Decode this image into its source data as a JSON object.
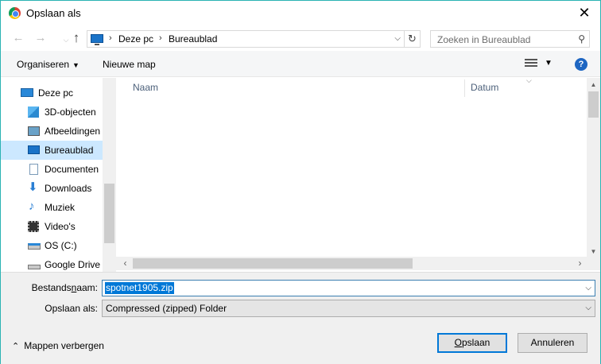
{
  "window": {
    "title": "Opslaan als",
    "close_symbol": "✕"
  },
  "nav": {
    "back_icon": "arrow-left-icon",
    "forward_icon": "arrow-right-icon",
    "up_icon": "arrow-up-icon"
  },
  "address": {
    "crumbs": [
      "Deze pc",
      "Bureaublad"
    ],
    "icon": "computer-icon"
  },
  "search": {
    "placeholder": "Zoeken in Bureaublad"
  },
  "toolbar": {
    "organize": "Organiseren",
    "new_folder": "Nieuwe map",
    "help": "?"
  },
  "sidebar": {
    "items": [
      {
        "label": "Deze pc",
        "icon": "computer-icon",
        "selected": false
      },
      {
        "label": "3D-objecten",
        "icon": "cube-icon",
        "selected": false
      },
      {
        "label": "Afbeeldingen",
        "icon": "pictures-icon",
        "selected": false
      },
      {
        "label": "Bureaublad",
        "icon": "desktop-icon",
        "selected": true
      },
      {
        "label": "Documenten",
        "icon": "documents-icon",
        "selected": false
      },
      {
        "label": "Downloads",
        "icon": "download-icon",
        "selected": false
      },
      {
        "label": "Muziek",
        "icon": "music-icon",
        "selected": false
      },
      {
        "label": "Video's",
        "icon": "video-icon",
        "selected": false
      },
      {
        "label": "OS (C:)",
        "icon": "drive-icon",
        "selected": false
      },
      {
        "label": "Google Drive F",
        "icon": "drive-icon",
        "selected": false
      }
    ]
  },
  "file_list": {
    "columns": [
      "Naam",
      "Datum"
    ]
  },
  "form": {
    "filename_label_pre": "Bestands",
    "filename_label_u": "n",
    "filename_label_post": "aam:",
    "filename_value": "spotnet1905.zip",
    "type_label_pre": "Opslaan als:",
    "type_value": "Compressed (zipped) Folder"
  },
  "footer": {
    "hide_folders": "Mappen verbergen",
    "save_pre": "",
    "save_u": "O",
    "save_post": "pslaan",
    "cancel": "Annuleren"
  }
}
